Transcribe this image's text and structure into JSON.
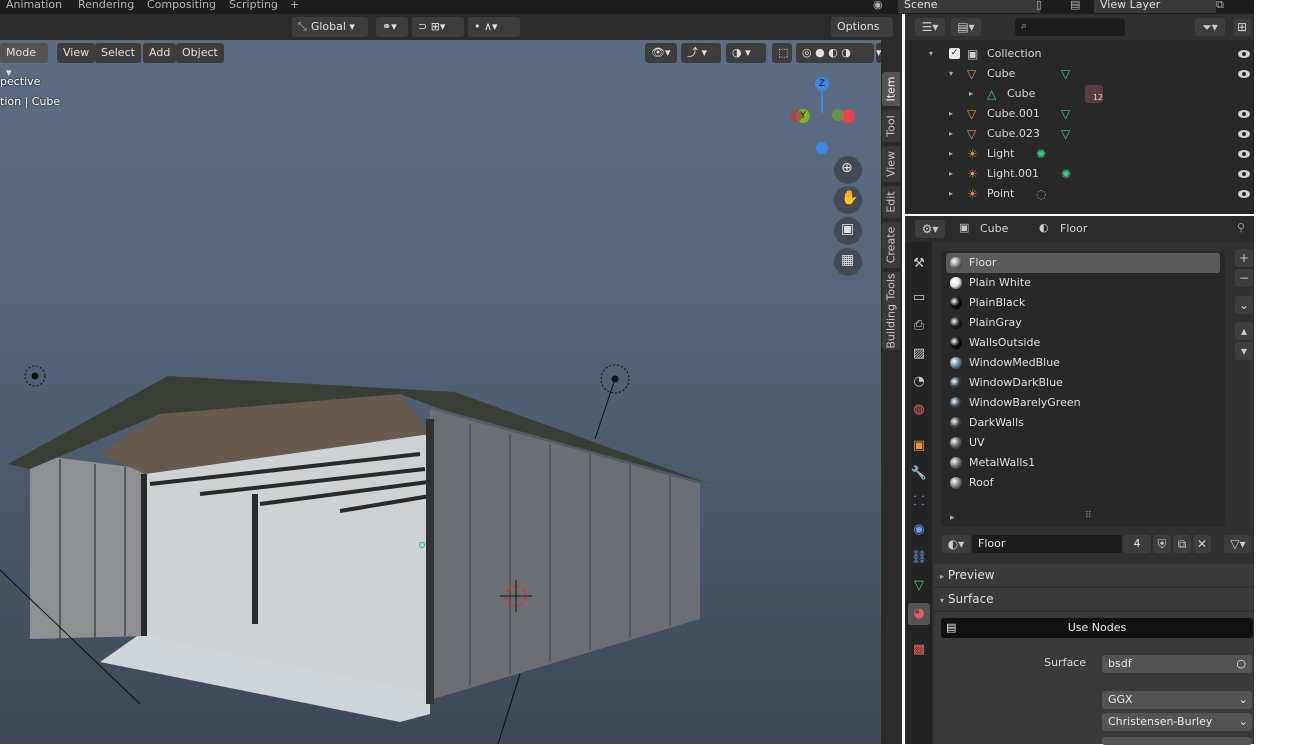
{
  "workspace_tabs": [
    "Animation",
    "Rendering",
    "Compositing",
    "Scripting",
    "+"
  ],
  "scene": {
    "label": "Scene",
    "view_layer": "View Layer"
  },
  "viewport_header": {
    "mode": "Mode",
    "menus": [
      "View",
      "Select",
      "Add",
      "Object"
    ],
    "orientation": "Global",
    "options": "Options"
  },
  "overlay_text": {
    "line1": "pective",
    "line2": "tion | Cube"
  },
  "gizmo": {
    "z": "Z",
    "y": "Y"
  },
  "npanel_tabs": [
    "Item",
    "Tool",
    "View",
    "Edit",
    "Create",
    "Building Tools"
  ],
  "outliner": {
    "search_placeholder": "",
    "rows": [
      {
        "name": "Collection",
        "indent": 0
      },
      {
        "name": "Cube",
        "indent": 1
      },
      {
        "name": "Cube",
        "indent": 2,
        "badge": "12"
      },
      {
        "name": "Cube.001",
        "indent": 1
      },
      {
        "name": "Cube.023",
        "indent": 1
      },
      {
        "name": "Light",
        "indent": 1
      },
      {
        "name": "Light.001",
        "indent": 1
      },
      {
        "name": "Point",
        "indent": 1
      }
    ]
  },
  "properties": {
    "breadcrumb_object": "Cube",
    "breadcrumb_material": "Floor",
    "materials": [
      "Floor",
      "Plain White",
      "PlainBlack",
      "PlainGray",
      "WallsOutside",
      "WindowMedBlue",
      "WindowDarkBlue",
      "WindowBarelyGreen",
      "DarkWalls",
      "UV",
      "MetalWalls1",
      "Roof"
    ],
    "active_material": "Floor",
    "material_field": "Floor",
    "user_count": "4",
    "panels": {
      "preview": "Preview",
      "surface": "Surface"
    },
    "use_nodes": "Use Nodes",
    "surface_label": "Surface",
    "surface_value": "bsdf",
    "distribution": "GGX",
    "subsurface": "Christensen-Burley"
  },
  "colors": {
    "accent": "#4772b3",
    "x_axis": "#e8434d",
    "y_axis": "#7ab52a",
    "z_axis": "#3f86e4",
    "active_row": "#5a5a5a"
  }
}
